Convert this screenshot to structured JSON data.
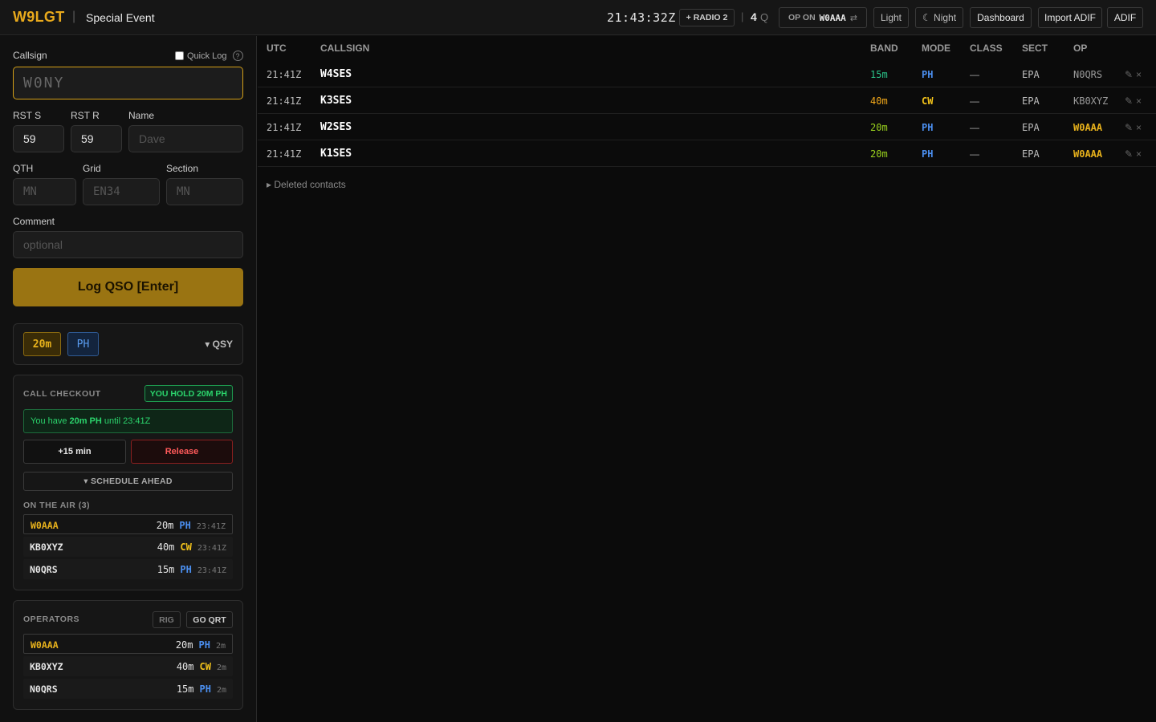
{
  "header": {
    "brand": "W9LGT",
    "separator": "|",
    "event_name": "Special Event",
    "clock": "21:43:32Z",
    "radio2_label": "+ RADIO 2",
    "pipe": "|",
    "qso_count": "4",
    "qso_unit": "Q",
    "op_on_label": "OP ON",
    "op_on_call": "W0AAA",
    "swap_glyph": "⇄",
    "light_label": "Light",
    "night_label": "☾ Night",
    "dashboard_label": "Dashboard",
    "import_label": "Import ADIF",
    "adif_label": "ADIF"
  },
  "form": {
    "callsign_label": "Callsign",
    "callsign_placeholder": "W0NY",
    "quicklog_label": "Quick Log",
    "help_glyph": "?",
    "rsts_label": "RST S",
    "rsts_value": "59",
    "rstr_label": "RST R",
    "rstr_value": "59",
    "name_label": "Name",
    "name_placeholder": "Dave",
    "qth_label": "QTH",
    "qth_placeholder": "MN",
    "grid_label": "Grid",
    "grid_placeholder": "EN34",
    "section_label": "Section",
    "section_placeholder": "MN",
    "comment_label": "Comment",
    "comment_placeholder": "optional",
    "log_button": "Log QSO [Enter]"
  },
  "band_panel": {
    "band": "20m",
    "mode": "PH",
    "qsy_label": "▾ QSY"
  },
  "checkout": {
    "title": "CALL CHECKOUT",
    "hold_badge": "YOU HOLD 20M PH",
    "msg_prefix": "You have",
    "msg_bold": "20m PH",
    "msg_suffix": "until 23:41Z",
    "extend_label": "+15 min",
    "release_label": "Release",
    "schedule_label": "▾ SCHEDULE AHEAD",
    "on_air_title": "ON THE AIR (3)",
    "on_air": [
      {
        "call": "W0AAA",
        "band": "20m",
        "mode": "PH",
        "time": "23:41Z"
      },
      {
        "call": "KB0XYZ",
        "band": "40m",
        "mode": "CW",
        "time": "23:41Z"
      },
      {
        "call": "N0QRS",
        "band": "15m",
        "mode": "PH",
        "time": "23:41Z"
      }
    ]
  },
  "operators": {
    "title": "OPERATORS",
    "rig_label": "RIG",
    "qrt_label": "GO QRT",
    "list": [
      {
        "call": "W0AAA",
        "band": "20m",
        "mode": "PH",
        "age": "2m"
      },
      {
        "call": "KB0XYZ",
        "band": "40m",
        "mode": "CW",
        "age": "2m"
      },
      {
        "call": "N0QRS",
        "band": "15m",
        "mode": "PH",
        "age": "2m"
      }
    ]
  },
  "log": {
    "headers": {
      "utc": "UTC",
      "callsign": "CALLSIGN",
      "band": "BAND",
      "mode": "MODE",
      "class": "CLASS",
      "sect": "SECT",
      "op": "OP"
    },
    "rows": [
      {
        "utc": "21:41Z",
        "call": "W4SES",
        "band": "15m",
        "mode": "PH",
        "class": "—",
        "sect": "EPA",
        "op": "N0QRS",
        "actions": "✎×"
      },
      {
        "utc": "21:41Z",
        "call": "K3SES",
        "band": "40m",
        "mode": "CW",
        "class": "—",
        "sect": "EPA",
        "op": "KB0XYZ",
        "actions": "✎×"
      },
      {
        "utc": "21:41Z",
        "call": "W2SES",
        "band": "20m",
        "mode": "PH",
        "class": "—",
        "sect": "EPA",
        "op": "W0AAA",
        "actions": "✎×"
      },
      {
        "utc": "21:41Z",
        "call": "K1SES",
        "band": "20m",
        "mode": "PH",
        "class": "—",
        "sect": "EPA",
        "op": "W0AAA",
        "actions": "✎×"
      }
    ],
    "deleted_label": "▸ Deleted contacts"
  },
  "colors": {
    "accent": "#e8a91c",
    "band_15m": "#2bc48a",
    "band_40m": "#f2a81a",
    "band_20m": "#9ad21e",
    "mode_ph": "#4b8ff0",
    "mode_cw": "#f2c21a",
    "op_self": "#e8b21c",
    "op_other": "#9a9a9a"
  }
}
